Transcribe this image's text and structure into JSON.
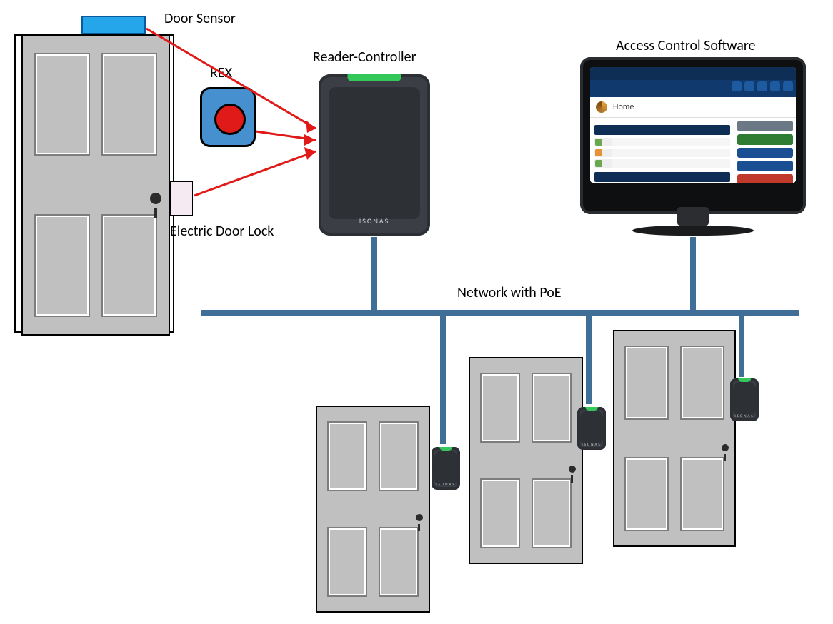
{
  "labels": {
    "door_sensor": "Door Sensor",
    "rex": "REX",
    "reader_controller": "Reader-Controller",
    "access_software": "Access Control Software",
    "lock": "Electric Door Lock",
    "network": "Network with PoE"
  },
  "reader_brand": "ISONAS",
  "software_home": "Home",
  "colors": {
    "network": "#3f6f97",
    "arrow": "#e01919",
    "sensor_fill": "#26a6ea",
    "led_green": "#34c759"
  },
  "doors_count": 4,
  "small_readers_count": 3
}
